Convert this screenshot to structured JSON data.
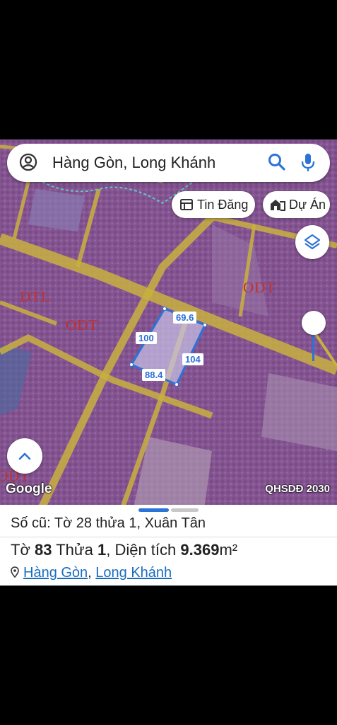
{
  "search": {
    "text": "Hàng Gòn, Long Khánh"
  },
  "chips": {
    "tin_dang": "Tin Đăng",
    "du_an": "Dự Án"
  },
  "map": {
    "labels": {
      "dtl": "DTL",
      "odt_left": "ODT",
      "odt_right": "ODT",
      "odt_corner": "ODT"
    },
    "edges": {
      "top": "69.6",
      "left": "100",
      "right": "104",
      "bottom": "88.4"
    },
    "google_logo": "Google",
    "plan_layer": "QHSDĐ 2030"
  },
  "sheet": {
    "old_parcel": "Số cũ: Tờ 28 thửa 1, Xuân Tân",
    "sheet_label": "Tờ",
    "sheet_no": "83",
    "parcel_label": "Thửa",
    "parcel_no": "1",
    "area_label": ", Diện tích",
    "area_value": "9.369",
    "area_unit": "m²",
    "commune": "Hàng Gòn",
    "separator": ",",
    "district": "Long Khánh"
  },
  "colors": {
    "accent": "#2b73d6",
    "zone_overlay": "#b060b0",
    "road": "#c8b040"
  }
}
